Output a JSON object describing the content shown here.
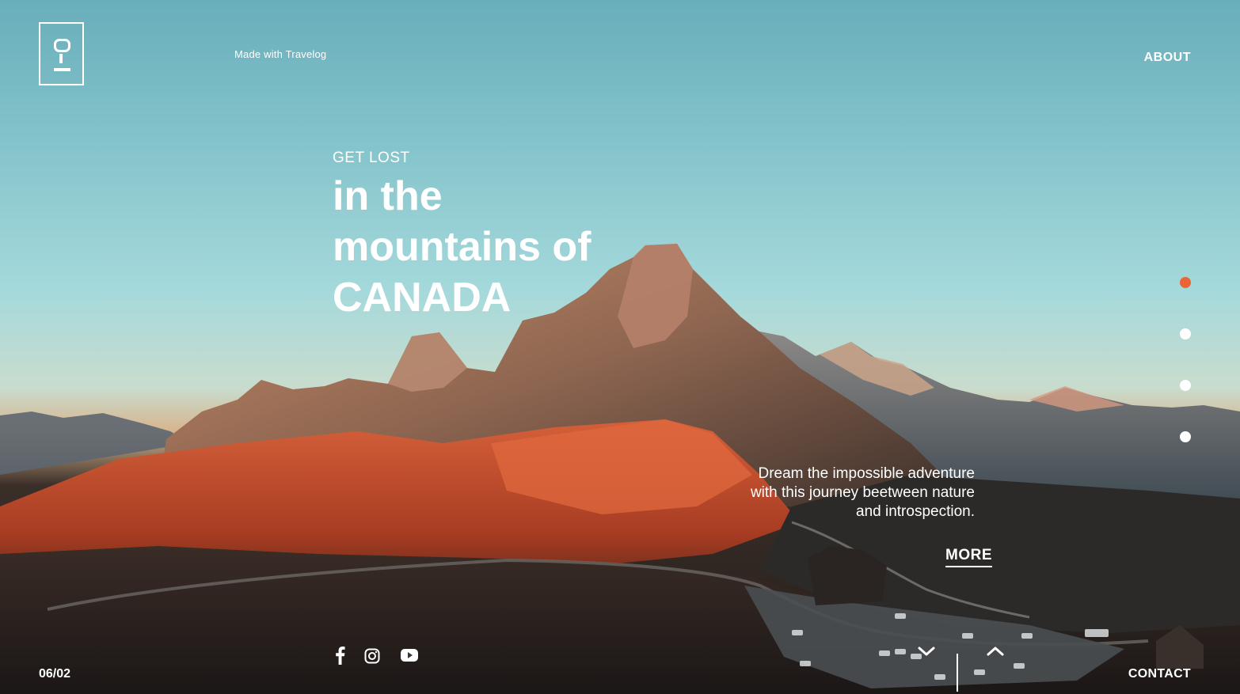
{
  "brand": {
    "logo_icon": "travelog-logo-icon",
    "made_with": "Made with Travelog"
  },
  "nav": {
    "about": "ABOUT",
    "contact": "CONTACT"
  },
  "hero": {
    "kicker": "GET LOST",
    "headline_lines": [
      "in the",
      "mountains of",
      "CANADA"
    ],
    "description": "Dream the impossible adventure with this journey beetween nature and introspection.",
    "more": "MORE"
  },
  "pager": {
    "count": 4,
    "active_index": 0,
    "active_color": "#ea6438",
    "inactive_color": "#ffffff"
  },
  "slide_counter": "06/02",
  "social": [
    {
      "icon": "facebook-icon"
    },
    {
      "icon": "instagram-icon"
    },
    {
      "icon": "youtube-icon"
    }
  ],
  "slide_nav": {
    "prev_icon": "chevron-down-icon",
    "next_icon": "chevron-up-icon"
  },
  "colors": {
    "accent": "#ea6438",
    "text": "#ffffff"
  }
}
